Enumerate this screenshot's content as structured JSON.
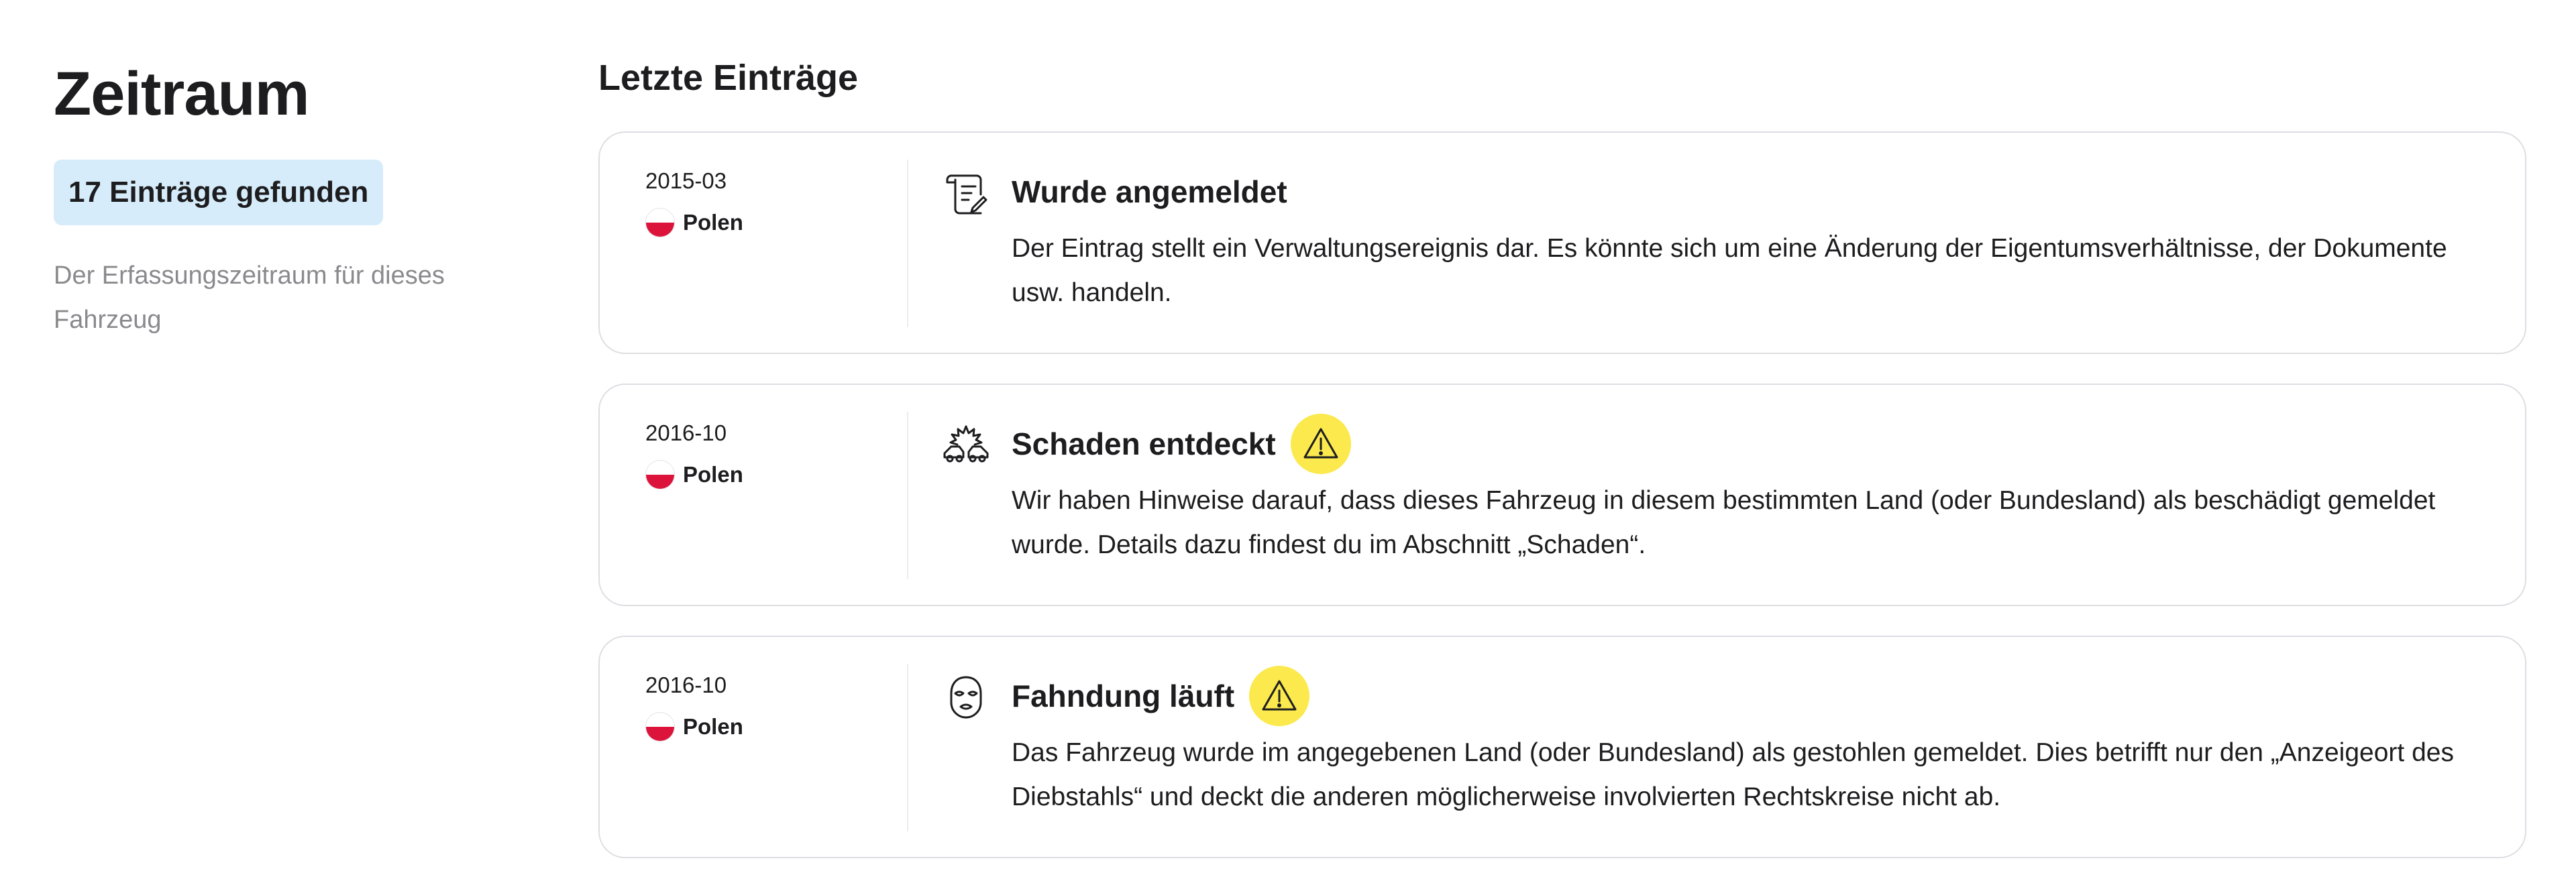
{
  "sidebar": {
    "title": "Zeitraum",
    "badge": "17 Einträge gefunden",
    "description": "Der Erfassungszeitraum für dieses Fahrzeug"
  },
  "main": {
    "heading": "Letzte Einträge",
    "entries": [
      {
        "date": "2015-03",
        "country": "Polen",
        "icon": "document-scroll-icon",
        "title": "Wurde angemeldet",
        "warning": false,
        "description": "Der Eintrag stellt ein Verwaltungsereignis dar. Es könnte sich um eine Änderung der Eigentumsverhältnisse, der Dokumente usw. handeln."
      },
      {
        "date": "2016-10",
        "country": "Polen",
        "icon": "car-crash-icon",
        "title": "Schaden entdeckt",
        "warning": true,
        "description": "Wir haben Hinweise darauf, dass dieses Fahrzeug in diesem bestimmten Land (oder Bundesland) als beschädigt gemeldet wurde. Details dazu findest du im Abschnitt „Schaden“."
      },
      {
        "date": "2016-10",
        "country": "Polen",
        "icon": "thief-mask-icon",
        "title": "Fahndung läuft",
        "warning": true,
        "description": "Das Fahrzeug wurde im angegebenen Land (oder Bundesland) als gestohlen gemeldet. Dies betrifft nur den „Anzeigeort des Diebstahls“ und deckt die anderen möglicherweise involvierten Rechtskreise nicht ab."
      }
    ]
  },
  "colors": {
    "badge_bg": "#d6ecfa",
    "warning_bg": "#fbe94d",
    "flag_red": "#dc143c",
    "muted_text": "#8a8a8e"
  }
}
